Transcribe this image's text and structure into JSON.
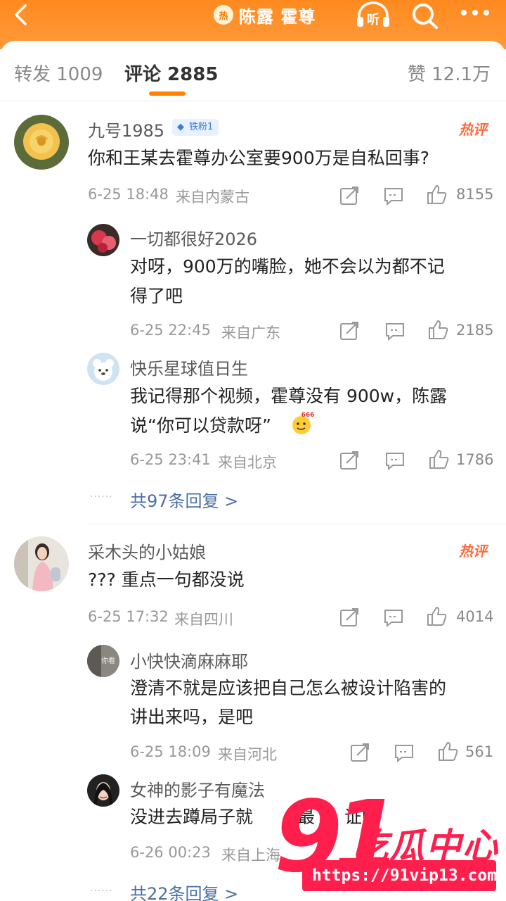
{
  "header": {
    "hot_badge": "热",
    "topic": "陈露 霍尊",
    "listen_label": "听",
    "icons": [
      "back-arrow-icon",
      "headphones-icon",
      "search-icon",
      "more-dots-icon"
    ],
    "background_color": "#ff8a1f"
  },
  "tabs": {
    "repost": "转发 1009",
    "comment": "评论 2885",
    "like": "赞 12.1万",
    "accent_color": "#ff8200"
  },
  "comments": [
    {
      "name": "九号1985",
      "badge": "铁粉1",
      "hot_tag": "热评",
      "text": "你和王某去霍尊办公室要900万是自私回事?",
      "time": "6-25 18:48",
      "location": "来自内蒙古",
      "likes": "8155",
      "replies": [
        {
          "name": "一切都很好2026",
          "text_line1": "对呀，900万的嘴脸，她不会以为都不记",
          "text_line2": "得了吧",
          "time": "6-25 22:45",
          "location": "来自广东",
          "likes": "2185"
        },
        {
          "name": "快乐星球值日生",
          "text_line1": "我记得那个视频，霍尊没有 900w，陈露",
          "text_line2": "说“你可以贷款呀”",
          "emoji_label": "666",
          "time": "6-25 23:41",
          "location": "来自北京",
          "likes": "1786"
        }
      ],
      "more_replies": "共97条回复 >"
    },
    {
      "name": "采木头的小姑娘",
      "hot_tag": "热评",
      "text": "??? 重点一句都没说",
      "time": "6-25 17:32",
      "location": "来自四川",
      "likes": "4014",
      "replies": [
        {
          "name": "小快快滴麻麻耶",
          "avatar_text": "你看",
          "text_line1": "澄清不就是应该把自己怎么被设计陷害的",
          "text_line2": "讲出来吗，是吧",
          "time": "6-25 18:09",
          "location": "来自河北",
          "likes": "561"
        },
        {
          "name": "女神的影子有魔法",
          "text_line1": "没进去蹲局子就",
          "text_line1_tail": "最",
          "text_line1_end": "证明",
          "time": "6-26 00:23",
          "location": "来自上海"
        }
      ],
      "more_replies": "共22条回复 >"
    }
  ],
  "watermark": {
    "number": "91",
    "title": "吃瓜中心",
    "url": "https://91vip13.com",
    "color": "#ff1f4d"
  }
}
